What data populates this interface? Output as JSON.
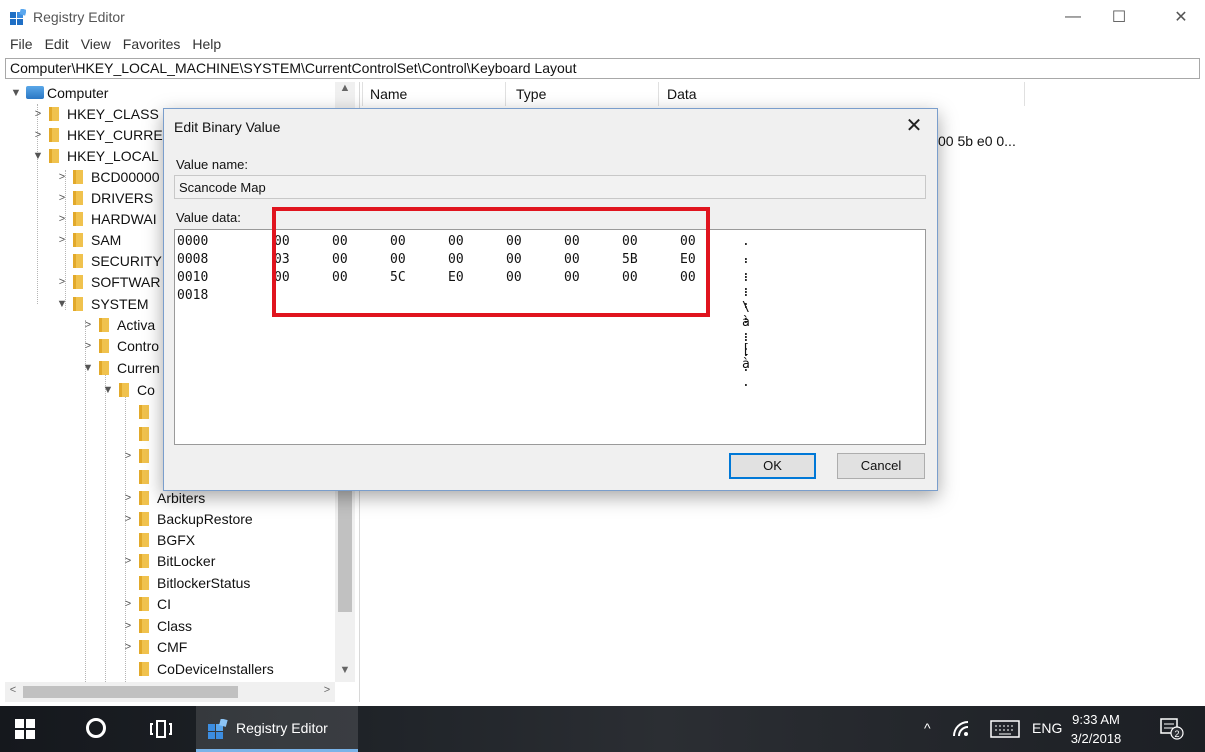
{
  "window": {
    "title": "Registry Editor",
    "minimize_glyph": "—",
    "maximize_glyph": "☐",
    "close_glyph": "✕"
  },
  "menu": [
    "File",
    "Edit",
    "View",
    "Favorites",
    "Help"
  ],
  "address": "Computer\\HKEY_LOCAL_MACHINE\\SYSTEM\\CurrentControlSet\\Control\\Keyboard Layout",
  "tree": {
    "root": "Computer",
    "items": [
      "HKEY_CLASS",
      "HKEY_CURRE",
      "HKEY_LOCAL",
      "BCD00000",
      "DRIVERS",
      "HARDWAI",
      "SAM",
      "SECURITY",
      "SOFTWAR",
      "SYSTEM",
      "Activa",
      "Contro",
      "Curren",
      "Co",
      "Arbiters",
      "BackupRestore",
      "BGFX",
      "BitLocker",
      "BitlockerStatus",
      "CI",
      "Class",
      "CMF",
      "CoDeviceInstallers"
    ]
  },
  "values": {
    "columns": [
      "Name",
      "Type",
      "Data"
    ],
    "data_peek": "00 5b e0 0..."
  },
  "dialog": {
    "title": "Edit Binary Value",
    "value_name_label": "Value name:",
    "value_name": "Scancode Map",
    "value_data_label": "Value data:",
    "rows": [
      {
        "offset": "0000",
        "bytes": [
          "00",
          "00",
          "00",
          "00",
          "00",
          "00",
          "00",
          "00"
        ],
        "ascii": ". . . . . . . ."
      },
      {
        "offset": "0008",
        "bytes": [
          "03",
          "00",
          "00",
          "00",
          "00",
          "00",
          "5B",
          "E0"
        ],
        "ascii": ". . . . . . [ à"
      },
      {
        "offset": "0010",
        "bytes": [
          "00",
          "00",
          "5C",
          "E0",
          "00",
          "00",
          "00",
          "00"
        ],
        "ascii": ". . \\ à . . . ."
      },
      {
        "offset": "0018",
        "bytes": [],
        "ascii": ""
      }
    ],
    "ok_label": "OK",
    "cancel_label": "Cancel",
    "close_glyph": "✕"
  },
  "taskbar": {
    "app_label": "Registry Editor",
    "language": "ENG",
    "time": "9:33 AM",
    "date": "3/2/2018",
    "notification_count": "2",
    "tray_up_glyph": "^"
  }
}
